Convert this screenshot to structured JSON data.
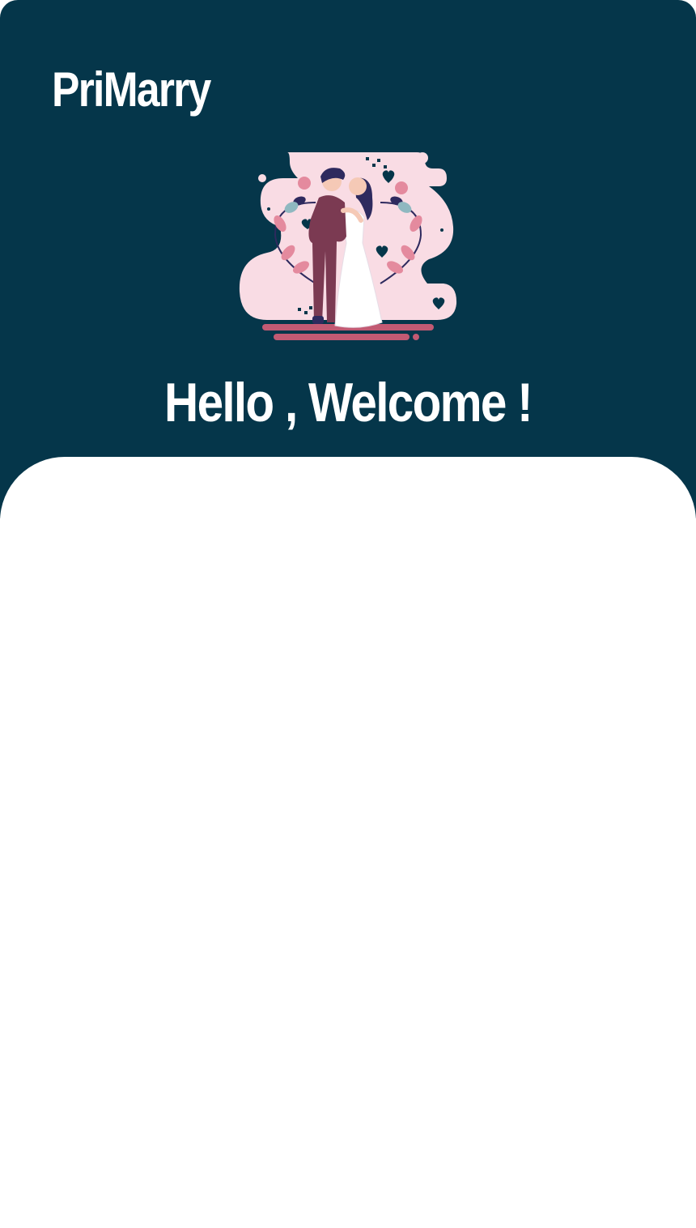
{
  "app": {
    "brand": "PriMarry"
  },
  "hero": {
    "illustration_icon": "wedding-couple-illustration",
    "welcome_text": "Hello , Welcome !"
  },
  "colors": {
    "header_bg": "#05364a",
    "sheet_bg": "#ffffff",
    "illustration_pink": "#f9dce4",
    "accent_rose": "#c25a73",
    "suit_maroon": "#7b3a52",
    "hair_navy": "#2e2a5e"
  }
}
